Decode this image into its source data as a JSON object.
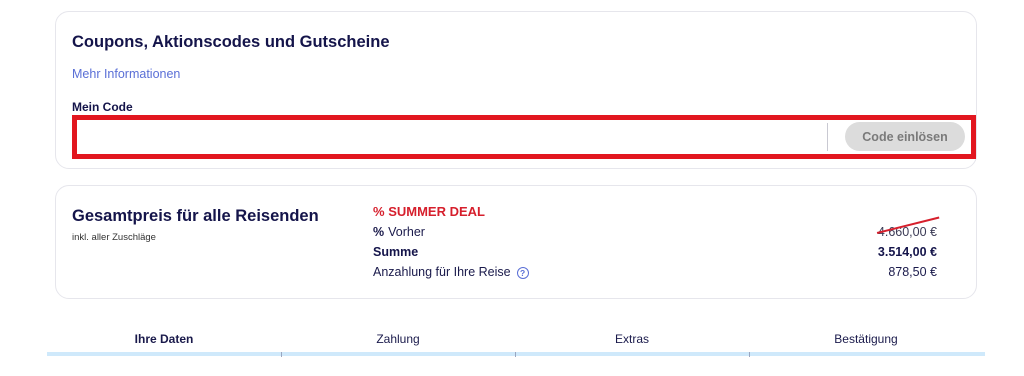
{
  "coupon": {
    "title": "Coupons, Aktionscodes und Gutscheine",
    "more_info_link": "Mehr Informationen",
    "code_label": "Mein Code",
    "code_value": "",
    "redeem_button": "Code einlösen"
  },
  "price": {
    "title": "Gesamtpreis für alle Reisenden",
    "subtitle": "inkl. aller Zuschläge",
    "deal_label": "SUMMER DEAL",
    "percent_symbol": "%",
    "previous_label": "Vorher",
    "previous_value": "4.660,00 €",
    "sum_label": "Summe",
    "sum_value": "3.514,00 €",
    "deposit_label": "Anzahlung für Ihre Reise",
    "deposit_value": "878,50 €",
    "help_icon": "question-circle-icon"
  },
  "steps": [
    {
      "label": "Ihre Daten",
      "active": true
    },
    {
      "label": "Zahlung",
      "active": false
    },
    {
      "label": "Extras",
      "active": false
    },
    {
      "label": "Bestätigung",
      "active": false
    }
  ],
  "colors": {
    "brand_navy": "#14144a",
    "link_blue": "#5a6fd6",
    "deal_red": "#d61f2c",
    "highlight_red": "#e2161f",
    "progress_bar": "#cfe9fb",
    "button_gray": "#dcdcdc"
  }
}
